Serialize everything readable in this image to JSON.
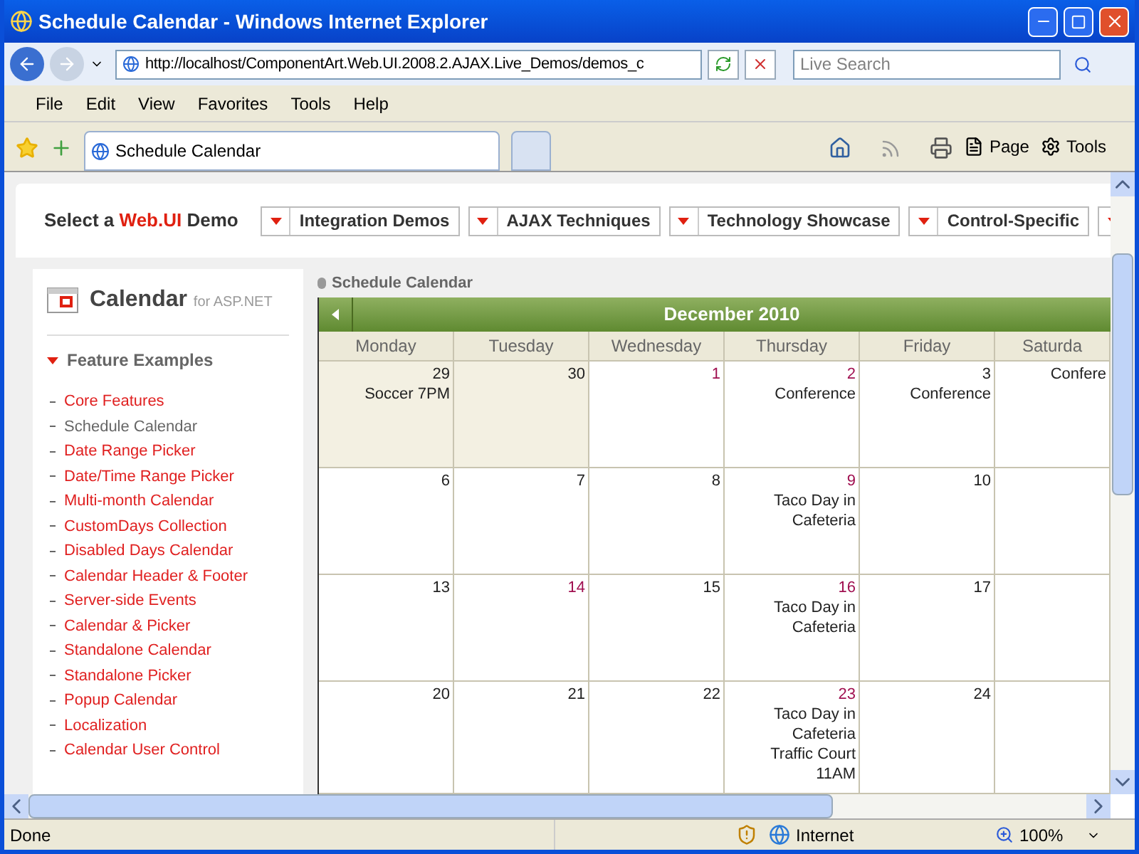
{
  "window": {
    "title": "Schedule Calendar - Windows Internet Explorer"
  },
  "address_bar": {
    "url": "http://localhost/ComponentArt.Web.UI.2008.2.AJAX.Live_Demos/demos_c",
    "search_placeholder": "Live Search"
  },
  "menu_bar": [
    "File",
    "Edit",
    "View",
    "Favorites",
    "Tools",
    "Help"
  ],
  "tabs": [
    {
      "label": "Schedule Calendar",
      "selected": true
    },
    {
      "selected": false
    }
  ],
  "command_bar": {
    "page": "Page",
    "tools": "Tools"
  },
  "demo_nav": {
    "prefix": "Select a",
    "brand": "Web.UI",
    "suffix": "Demo",
    "menus": [
      {
        "label": "Integration Demos"
      },
      {
        "label": "AJAX Techniques"
      },
      {
        "label": "Technology Showcase"
      },
      {
        "label": "Control-Specific"
      }
    ],
    "more_menu": true
  },
  "sidebar": {
    "product": "Calendar",
    "product_suffix": "for ASP.NET",
    "section": {
      "title": "Feature Examples",
      "expanded": true
    },
    "items": [
      {
        "label": "Core Features",
        "selected": false
      },
      {
        "label": "Schedule Calendar",
        "selected": true
      },
      {
        "label": "Date Range Picker",
        "selected": false
      },
      {
        "label": "Date/Time Range Picker",
        "selected": false
      },
      {
        "label": "Multi-month Calendar",
        "selected": false
      },
      {
        "label": "CustomDays Collection",
        "selected": false
      },
      {
        "label": "Disabled Days Calendar",
        "selected": false
      },
      {
        "label": "Calendar Header & Footer",
        "selected": false
      },
      {
        "label": "Server-side Events",
        "selected": false
      },
      {
        "label": "Calendar & Picker",
        "selected": false
      },
      {
        "label": "Standalone Calendar",
        "selected": false
      },
      {
        "label": "Standalone Picker",
        "selected": false
      },
      {
        "label": "Popup Calendar",
        "selected": false
      },
      {
        "label": "Localization",
        "selected": false
      },
      {
        "label": "Calendar User Control",
        "selected": false
      }
    ]
  },
  "calendar": {
    "heading": "Schedule Calendar",
    "month": "December 2010",
    "weekdays": [
      "Monday",
      "Tuesday",
      "Wednesday",
      "Thursday",
      "Friday",
      "Saturda"
    ],
    "weeks": [
      [
        {
          "day": "29",
          "other_month": true,
          "highlighted": false,
          "events": [
            "Soccer 7PM"
          ]
        },
        {
          "day": "30",
          "other_month": true,
          "highlighted": false
        },
        {
          "day": "1",
          "other_month": false,
          "highlighted": true
        },
        {
          "day": "2",
          "other_month": false,
          "highlighted": true,
          "events": [
            "Conference"
          ]
        },
        {
          "day": "3",
          "other_month": false,
          "highlighted": false,
          "events": [
            "Conference"
          ]
        },
        {
          "other_month": false,
          "events": [
            "Confere"
          ]
        }
      ],
      [
        {
          "day": "6",
          "other_month": false,
          "highlighted": false
        },
        {
          "day": "7",
          "other_month": false,
          "highlighted": false
        },
        {
          "day": "8",
          "other_month": false,
          "highlighted": false
        },
        {
          "day": "9",
          "other_month": false,
          "highlighted": true,
          "events": [
            "Taco Day in Cafeteria"
          ]
        },
        {
          "day": "10",
          "other_month": false,
          "highlighted": false
        },
        {
          "other_month": false
        }
      ],
      [
        {
          "day": "13",
          "other_month": false,
          "highlighted": false
        },
        {
          "day": "14",
          "other_month": false,
          "highlighted": true
        },
        {
          "day": "15",
          "other_month": false,
          "highlighted": false
        },
        {
          "day": "16",
          "other_month": false,
          "highlighted": true,
          "events": [
            "Taco Day in Cafeteria"
          ]
        },
        {
          "day": "17",
          "other_month": false,
          "highlighted": false
        },
        {
          "other_month": false
        }
      ],
      [
        {
          "day": "20",
          "other_month": false,
          "highlighted": false
        },
        {
          "day": "21",
          "other_month": false,
          "highlighted": false
        },
        {
          "day": "22",
          "other_month": false,
          "highlighted": false
        },
        {
          "day": "23",
          "other_month": false,
          "highlighted": true,
          "events": [
            "Taco Day in Cafeteria",
            "Traffic Court 11AM"
          ]
        },
        {
          "day": "24",
          "other_month": false,
          "highlighted": false
        },
        {
          "other_month": false
        }
      ]
    ]
  },
  "status_bar": {
    "status": "Done",
    "zone": "Internet",
    "zoom": "100%"
  }
}
